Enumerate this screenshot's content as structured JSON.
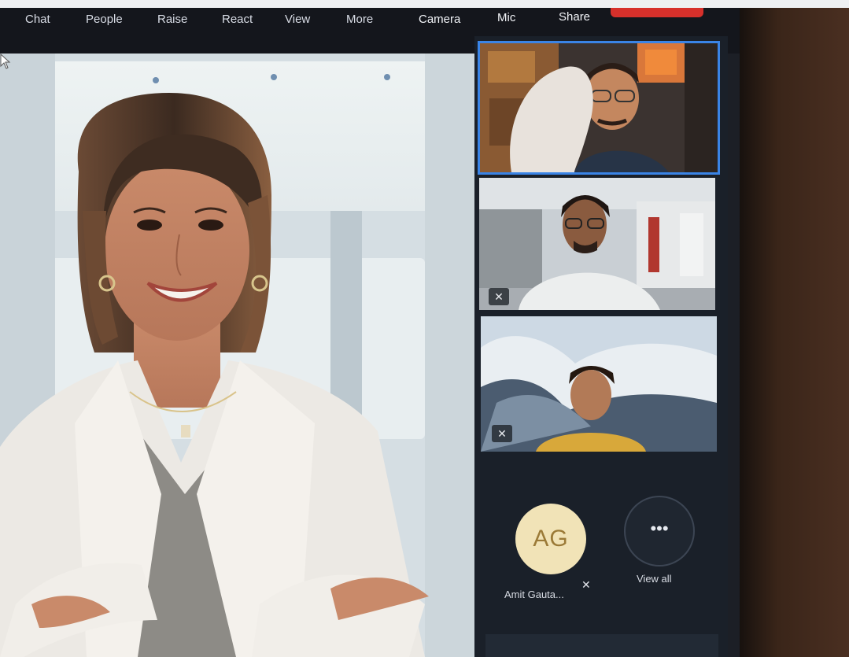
{
  "toolbar": {
    "items": [
      {
        "label": "Chat",
        "icon": "chat-icon"
      },
      {
        "label": "People",
        "icon": "people-icon"
      },
      {
        "label": "Raise",
        "icon": "raise-hand-icon"
      },
      {
        "label": "React",
        "icon": "react-icon"
      },
      {
        "label": "View",
        "icon": "view-icon"
      },
      {
        "label": "More",
        "icon": "more-icon"
      },
      {
        "label": "Camera",
        "icon": "camera-icon"
      },
      {
        "label": "Mic",
        "icon": "mic-icon"
      },
      {
        "label": "Share",
        "icon": "share-icon"
      }
    ],
    "leave_color": "#d7302b"
  },
  "participants": {
    "avatar_initials": "AG",
    "avatar_name": "Amit Gauta...",
    "view_all_label": "View all",
    "view_all_icon": "ellipsis-icon",
    "muted_icon": "mic-off-icon"
  },
  "colors": {
    "active_speaker_border": "#3a84e6",
    "avatar_bg": "#f1e3b7",
    "avatar_text": "#9b7a37",
    "panel_bg": "#1a2029"
  }
}
